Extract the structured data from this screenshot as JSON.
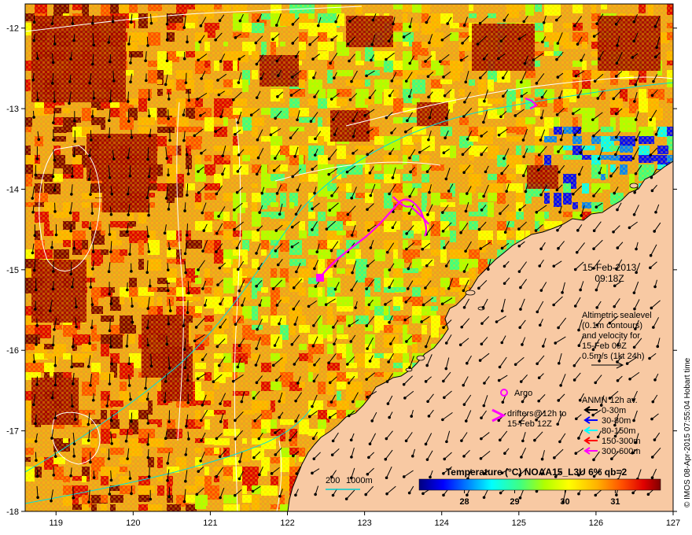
{
  "map": {
    "lon_ticks": [
      "119",
      "120",
      "121",
      "122",
      "123",
      "124",
      "125",
      "126",
      "127"
    ],
    "lat_ticks": [
      "-12",
      "-13",
      "-14",
      "-15",
      "-16",
      "-17",
      "-18"
    ],
    "lon_range": [
      118.6,
      127
    ],
    "lat_range": [
      -18,
      -11.7
    ],
    "land_color": "#f8c9a3"
  },
  "date_block": {
    "date": "15-Feb-2013",
    "time": "09:18Z"
  },
  "altimetry_note": {
    "lines": [
      "Altimetric sealevel",
      "(0.1m contours)",
      "and velocity for",
      "15-Feb 09Z",
      "0.5m/s (1kt 24h)"
    ]
  },
  "legend": {
    "argo_label": "Argo",
    "drifters_line1": "drifters@12h to",
    "drifters_line2": "15-Feb 12Z",
    "anmn_title": "ANMN 12h av.",
    "anmn_items": [
      {
        "label": "0-30m",
        "color": "#000000"
      },
      {
        "label": "30-80m",
        "color": "#0000ff"
      },
      {
        "label": "80-150m",
        "color": "#00ffff"
      },
      {
        "label": "150-300m",
        "color": "#ff0000"
      },
      {
        "label": "300-600m",
        "color": "#ff00ff"
      }
    ]
  },
  "scale_bar": {
    "label_a": "200",
    "label_b": "1000m"
  },
  "colorbar": {
    "title": "Temperature (°C) NOAA15_L3U 6% qb=2",
    "ticks": [
      "28",
      "29",
      "30",
      "31"
    ],
    "tick_values": [
      28,
      29,
      30,
      31
    ],
    "range": [
      27.1,
      31.9
    ],
    "colors": [
      "#00007f",
      "#0000ff",
      "#0080ff",
      "#00ffff",
      "#40ff80",
      "#b0ff00",
      "#ffff00",
      "#ffb000",
      "#ff5000",
      "#e00000",
      "#800000"
    ]
  },
  "credit": "© IMOS 08-Apr-2015 07:55:04 Hobart time"
}
